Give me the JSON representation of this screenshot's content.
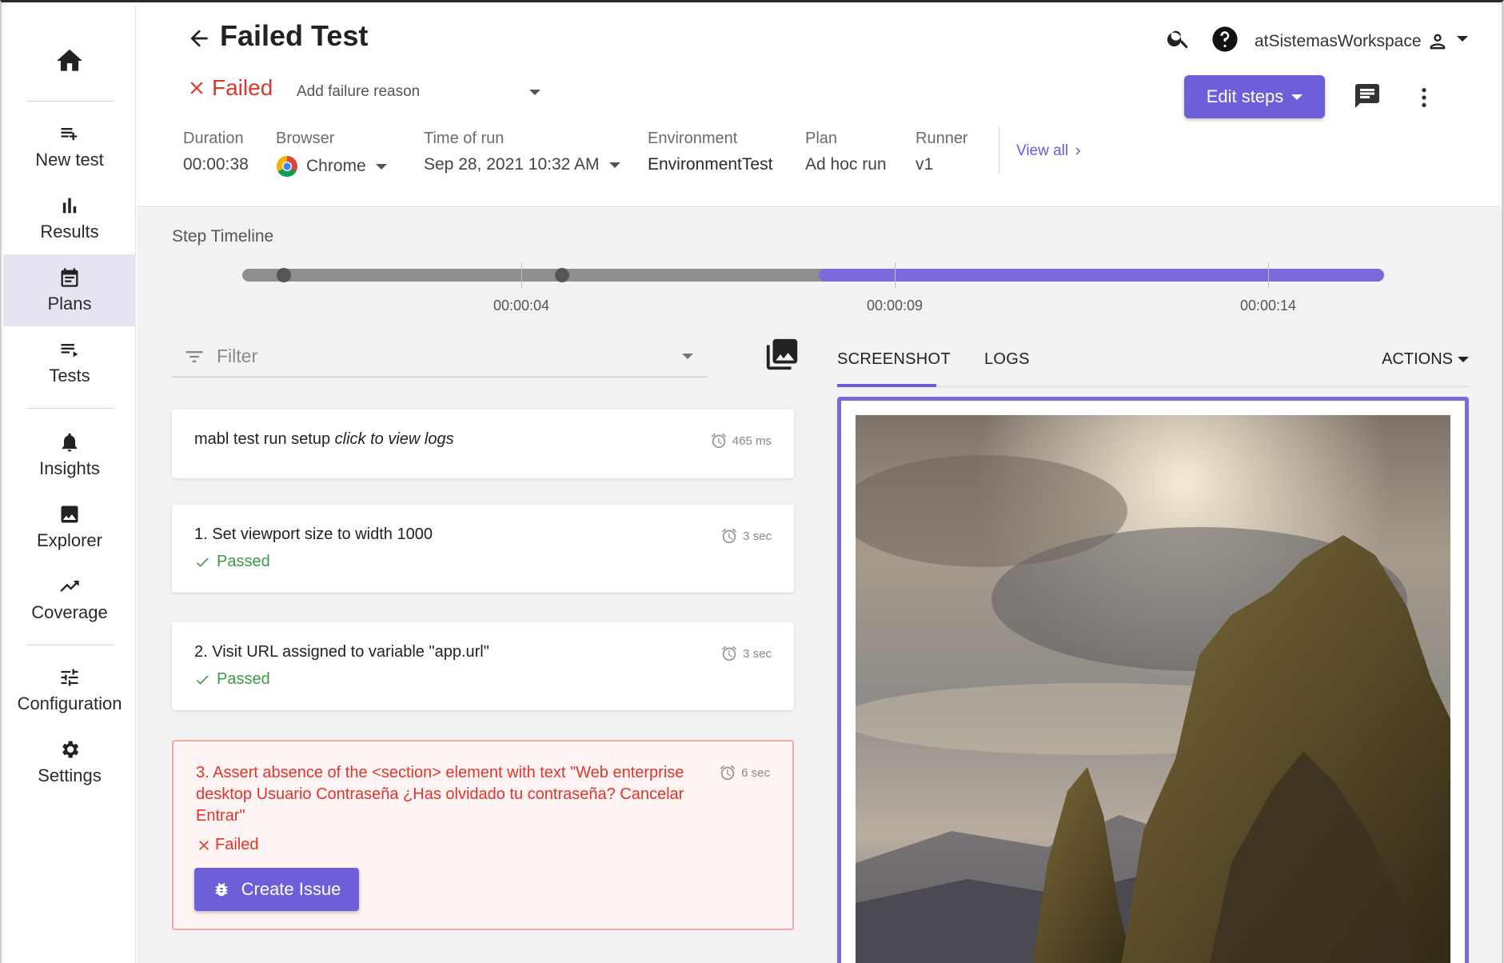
{
  "sidebar": {
    "items": [
      {
        "label": "New test",
        "icon": "playlist-add-icon"
      },
      {
        "label": "Results",
        "icon": "bar-chart-icon"
      },
      {
        "label": "Plans",
        "icon": "calendar-icon"
      },
      {
        "label": "Tests",
        "icon": "list-icon"
      },
      {
        "label": "Insights",
        "icon": "bell-icon"
      },
      {
        "label": "Explorer",
        "icon": "image-icon"
      },
      {
        "label": "Coverage",
        "icon": "trending-up-icon"
      },
      {
        "label": "Configuration",
        "icon": "sliders-icon"
      },
      {
        "label": "Settings",
        "icon": "gear-icon"
      }
    ],
    "active": "Plans"
  },
  "header": {
    "title": "Failed Test",
    "status": "Failed",
    "failure_reason_placeholder": "Add failure reason",
    "workspace": "atSistemasWorkspace",
    "edit_steps": "Edit steps",
    "meta": {
      "duration_label": "Duration",
      "duration": "00:00:38",
      "browser_label": "Browser",
      "browser": "Chrome",
      "time_label": "Time of run",
      "time": "Sep 28, 2021 10:32 AM",
      "environment_label": "Environment",
      "environment": "EnvironmentTest",
      "plan_label": "Plan",
      "plan": "Ad hoc run",
      "runner_label": "Runner",
      "runner": "v1"
    },
    "view_all": "View all"
  },
  "timeline": {
    "label": "Step Timeline",
    "ticks": [
      "00:00:04",
      "00:00:09",
      "00:00:14"
    ],
    "progress_fraction_start": 0.5
  },
  "filter": {
    "placeholder": "Filter"
  },
  "steps": [
    {
      "text": "mabl test run setup",
      "link_text": "click to view logs",
      "duration": "465 ms"
    },
    {
      "text": "1. Set viewport size to width 1000",
      "duration": "3 sec",
      "status": "Passed"
    },
    {
      "text": "2. Visit URL assigned to variable \"app.url\"",
      "duration": "3 sec",
      "status": "Passed"
    },
    {
      "text_line1": "3. Assert absence of the <section> element with text \"Web enterprise",
      "text_line2": "desktop Usuario Contraseña ¿Has olvidado tu contraseña? Cancelar",
      "text_line3": "Entrar\"",
      "duration": "6 sec",
      "status": "Failed",
      "button": "Create Issue"
    }
  ],
  "panel": {
    "tabs": [
      "SCREENSHOT",
      "LOGS"
    ],
    "active_tab": "SCREENSHOT",
    "actions": "ACTIONS"
  },
  "colors": {
    "accent": "#6d5fd8",
    "failed": "#e0352b",
    "passed": "#3c9a47",
    "timeline_fill": "#7a6ad9"
  }
}
